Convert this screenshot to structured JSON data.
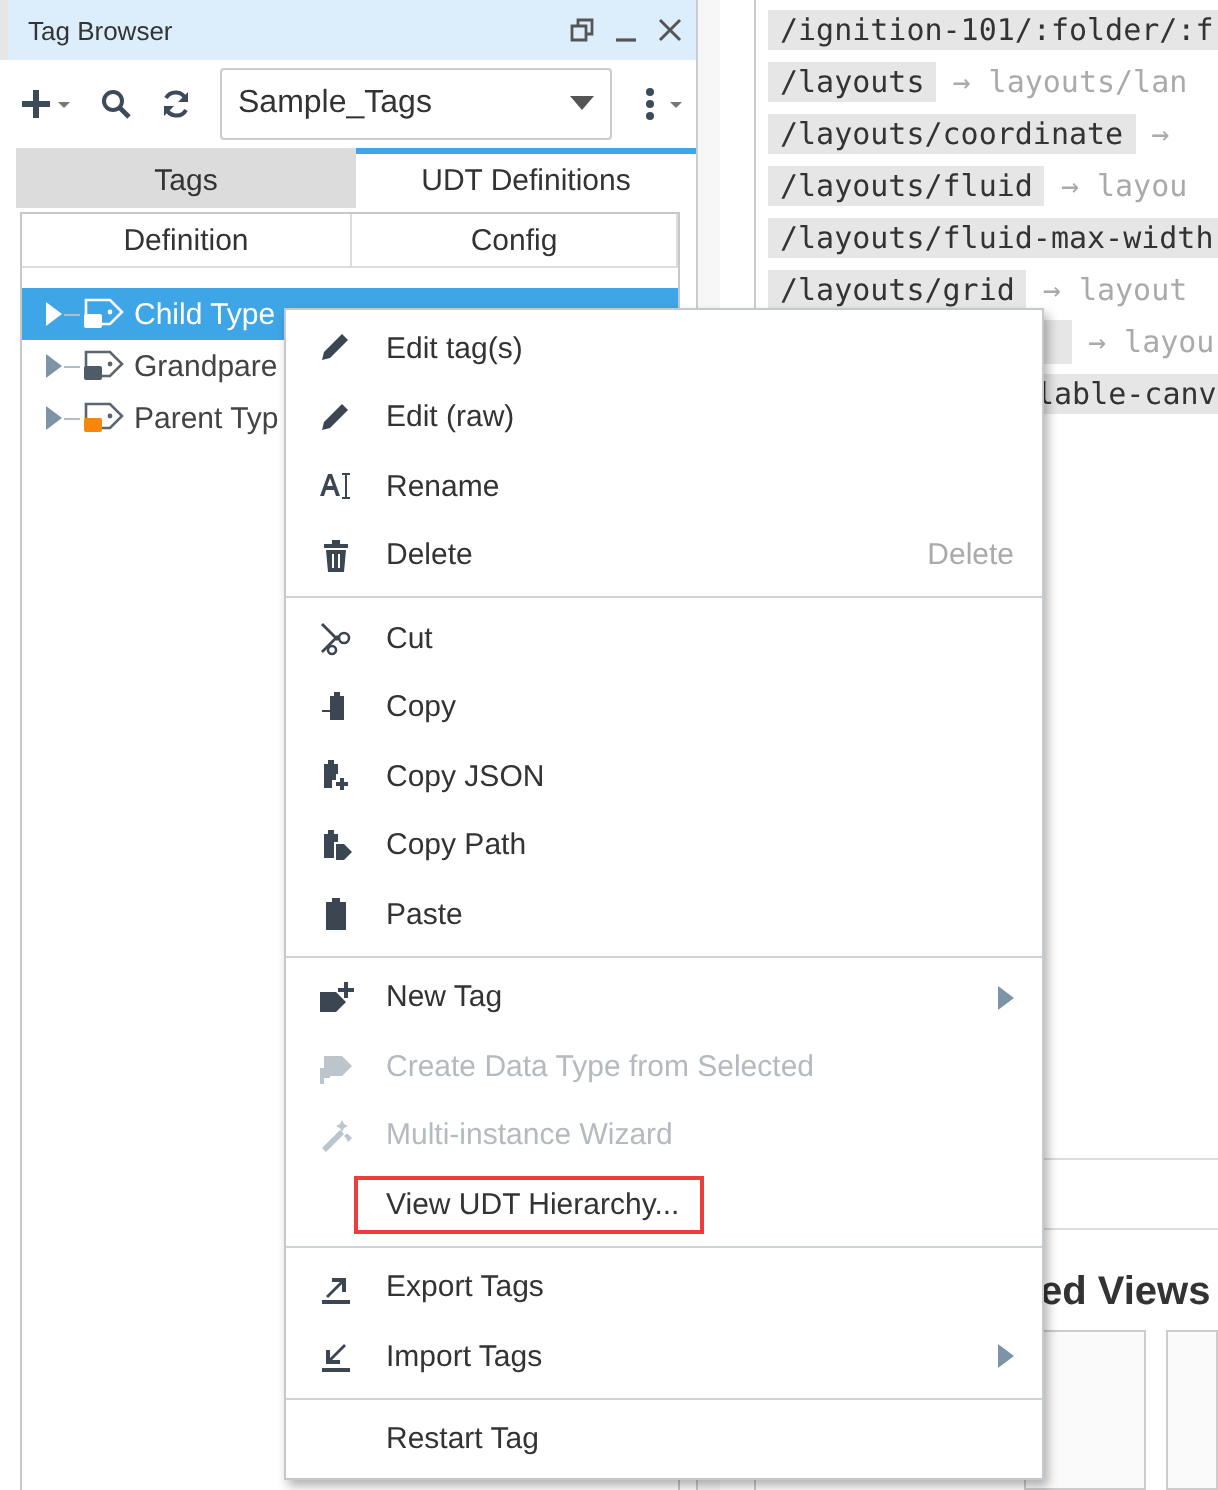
{
  "panel": {
    "title": "Tag Browser",
    "provider": "Sample_Tags",
    "tabs": [
      {
        "label": "Tags",
        "selected": false
      },
      {
        "label": "UDT Definitions",
        "selected": true
      }
    ],
    "columns": [
      "Definition",
      "Config"
    ],
    "tree": [
      {
        "label": "Child Type",
        "selected": true,
        "color": "#ffffff"
      },
      {
        "label": "Grandpare",
        "selected": false,
        "color": "#505b68"
      },
      {
        "label": "Parent Typ",
        "selected": false,
        "color": "#f7860e"
      }
    ]
  },
  "paths": [
    {
      "kind": "full",
      "path": "/ignition-101/:folder/:f"
    },
    {
      "kind": "full",
      "path": "/layouts",
      "target": "→ layouts/lan"
    },
    {
      "kind": "full",
      "path": "/layouts/coordinate",
      "target": "→"
    },
    {
      "kind": "full",
      "path": "/layouts/fluid",
      "target": "→ layou"
    },
    {
      "kind": "full",
      "path": "/layouts/fluid-max-width"
    },
    {
      "kind": "full",
      "path": "/layouts/grid",
      "target": "→ layout"
    },
    {
      "kind": "covered",
      "target": "→ layou"
    },
    {
      "kind": "covered",
      "path": "lable-canv"
    }
  ],
  "views_heading": "ed Views",
  "context_menu": {
    "items": [
      {
        "kind": "item",
        "label": "Edit tag(s)",
        "disabled": false,
        "submenu": false,
        "highlighted": false
      },
      {
        "kind": "item",
        "label": "Edit (raw)",
        "disabled": false,
        "submenu": false,
        "highlighted": false
      },
      {
        "kind": "item",
        "label": "Rename",
        "disabled": false,
        "submenu": false,
        "highlighted": false
      },
      {
        "kind": "item",
        "label": "Delete",
        "shortcut": "Delete",
        "disabled": false,
        "submenu": false,
        "highlighted": false
      },
      {
        "kind": "separator"
      },
      {
        "kind": "item",
        "label": "Cut",
        "disabled": false,
        "submenu": false,
        "highlighted": false
      },
      {
        "kind": "item",
        "label": "Copy",
        "disabled": false,
        "submenu": false,
        "highlighted": false
      },
      {
        "kind": "item",
        "label": "Copy JSON",
        "disabled": false,
        "submenu": false,
        "highlighted": false
      },
      {
        "kind": "item",
        "label": "Copy Path",
        "disabled": false,
        "submenu": false,
        "highlighted": false
      },
      {
        "kind": "item",
        "label": "Paste",
        "disabled": false,
        "submenu": false,
        "highlighted": false
      },
      {
        "kind": "separator"
      },
      {
        "kind": "item",
        "label": "New Tag",
        "disabled": false,
        "submenu": true,
        "highlighted": false
      },
      {
        "kind": "item",
        "label": "Create Data Type from Selected",
        "disabled": true,
        "submenu": false,
        "highlighted": false
      },
      {
        "kind": "item",
        "label": "Multi-instance Wizard",
        "disabled": true,
        "submenu": false,
        "highlighted": false
      },
      {
        "kind": "item",
        "label": "View UDT Hierarchy...",
        "disabled": false,
        "submenu": false,
        "highlighted": true
      },
      {
        "kind": "separator"
      },
      {
        "kind": "item",
        "label": "Export Tags",
        "disabled": false,
        "submenu": false,
        "highlighted": false
      },
      {
        "kind": "item",
        "label": "Import Tags",
        "disabled": false,
        "submenu": true,
        "highlighted": false
      },
      {
        "kind": "separator"
      },
      {
        "kind": "item",
        "label": "Restart Tag",
        "disabled": false,
        "submenu": false,
        "highlighted": false
      }
    ]
  }
}
